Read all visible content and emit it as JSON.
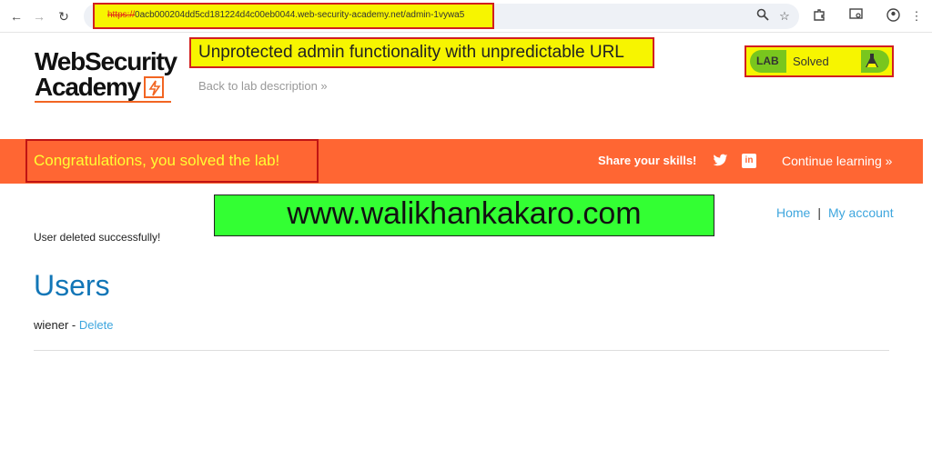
{
  "browser": {
    "url_scheme": "https://",
    "url_rest": "0acb000204dd5cd181224d4c00eb0044.web-security-academy.net/admin-1vywa5",
    "icons": [
      "back-arrow-icon",
      "forward-arrow-icon",
      "reload-icon",
      "zoom-icon",
      "star-icon",
      "extensions-icon",
      "cast-icon",
      "profile-icon",
      "menu-dots-icon"
    ]
  },
  "header": {
    "logo_line1": "WebSecurity",
    "logo_line2": "Academy",
    "lab_title": "Unprotected admin functionality with unpredictable URL",
    "back_link": "Back to lab description",
    "status_label": "LAB",
    "status_value": "Solved"
  },
  "banner": {
    "message": "Congratulations, you solved the lab!",
    "share": "Share your skills!",
    "continue": "Continue learning"
  },
  "watermark": "www.walikhankakaro.com",
  "nav": {
    "home": "Home",
    "separator": "|",
    "account": "My account"
  },
  "main": {
    "message": "User deleted successfully!",
    "title": "Users",
    "users": [
      {
        "name": "wiener",
        "separator": " - ",
        "action": "Delete"
      }
    ]
  },
  "colors": {
    "banner": "#ff6633",
    "status_green": "#79c61e",
    "highlight_yellow": "#f7f500",
    "title_blue": "#1276b7",
    "link_blue": "#3ea6de"
  }
}
